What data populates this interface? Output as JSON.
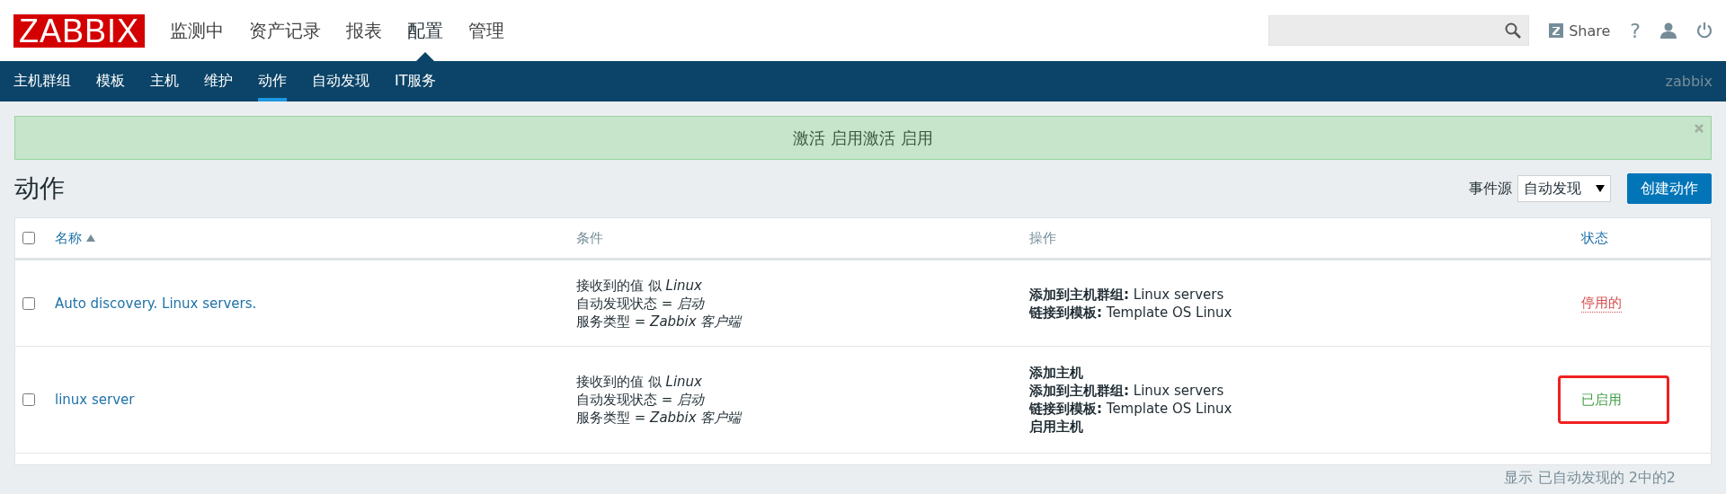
{
  "logo": "ZABBIX",
  "main_menu": [
    {
      "label": "监测中",
      "selected": false
    },
    {
      "label": "资产记录",
      "selected": false
    },
    {
      "label": "报表",
      "selected": false
    },
    {
      "label": "配置",
      "selected": true
    },
    {
      "label": "管理",
      "selected": false
    }
  ],
  "share": "Share",
  "help": "?",
  "sub_menu": [
    {
      "label": "主机群组",
      "selected": false
    },
    {
      "label": "模板",
      "selected": false
    },
    {
      "label": "主机",
      "selected": false
    },
    {
      "label": "维护",
      "selected": false
    },
    {
      "label": "动作",
      "selected": true
    },
    {
      "label": "自动发现",
      "selected": false
    },
    {
      "label": "IT服务",
      "selected": false
    }
  ],
  "user": "zabbix",
  "message": "激活 启用激活 启用",
  "page_title": "动作",
  "event_source": {
    "label": "事件源",
    "value": "自动发现"
  },
  "create_button": "创建动作",
  "select_all": {
    "checked": false
  },
  "table": {
    "columns": [
      {
        "label": "名称",
        "sortable": true,
        "sorted": true
      },
      {
        "label": "条件",
        "sortable": false,
        "sorted": false
      },
      {
        "label": "操作",
        "sortable": false,
        "sorted": false
      },
      {
        "label": "状态",
        "sortable": true,
        "sorted": false
      }
    ],
    "rows": [
      {
        "checked": false,
        "name": "Auto discovery. Linux servers.",
        "conditions": [
          "接收到的值 似 *Linux*",
          "自动发现状态 = *启动*",
          "服务类型 = *Zabbix 客户端*"
        ],
        "operations": [
          {
            "label": "添加到主机群组:",
            "value": "Linux servers"
          },
          {
            "label": "链接到模板:",
            "value": "Template OS Linux"
          }
        ],
        "status": {
          "text": "停用的",
          "enabled": false
        },
        "highlighted": false
      },
      {
        "checked": false,
        "name": "linux server",
        "conditions": [
          "接收到的值 似 *Linux*",
          "自动发现状态 = *启动*",
          "服务类型 = *Zabbix 客户端*"
        ],
        "operations": [
          {
            "label": "添加主机"
          },
          {
            "label": "添加到主机群组:",
            "value": "Linux servers"
          },
          {
            "label": "链接到模板:",
            "value": "Template OS Linux"
          },
          {
            "label": "启用主机"
          }
        ],
        "status": {
          "text": "已启用",
          "enabled": true
        },
        "highlighted": true
      }
    ]
  },
  "footer": "显示 已自动发现的 2中的2"
}
